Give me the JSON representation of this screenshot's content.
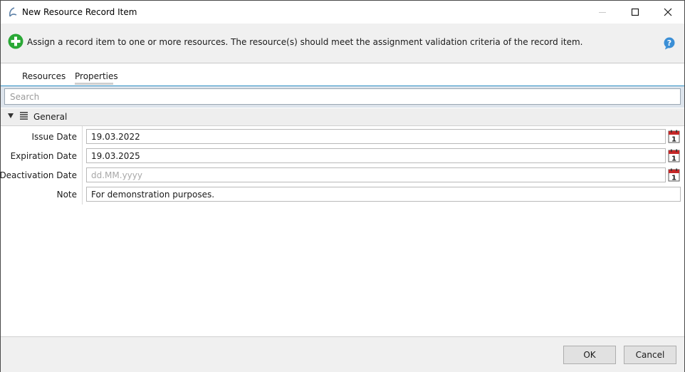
{
  "window": {
    "title": "New Resource Record Item",
    "icon": "app-logo-icon",
    "controls": [
      "minimize-icon",
      "maximize-icon",
      "close-icon"
    ]
  },
  "info": {
    "icon": "add-green-icon",
    "text": "Assign a record item to one or more resources. The resource(s) should meet the assignment validation criteria of the record item.",
    "help_icon": "help-icon"
  },
  "tabs": [
    {
      "label": "Resources",
      "selected": false
    },
    {
      "label": "Properties",
      "selected": true
    }
  ],
  "search": {
    "placeholder": "Search",
    "value": ""
  },
  "category": {
    "label": "General",
    "expanded": true
  },
  "properties": {
    "issue_date": {
      "label": "Issue Date",
      "value": "19.03.2022",
      "placeholder": ""
    },
    "expiration_date": {
      "label": "Expiration Date",
      "value": "19.03.2025",
      "placeholder": ""
    },
    "deactivation_date": {
      "label": "Deactivation Date",
      "value": "",
      "placeholder": "dd.MM.yyyy"
    },
    "note": {
      "label": "Note",
      "value": "For demonstration purposes."
    }
  },
  "buttons": {
    "ok": "OK",
    "cancel": "Cancel"
  },
  "colors": {
    "accent_line": "#2d8fc4",
    "add_icon_green": "#2aa836",
    "help_icon_blue": "#3b8fd6",
    "calendar_red": "#c62828"
  }
}
